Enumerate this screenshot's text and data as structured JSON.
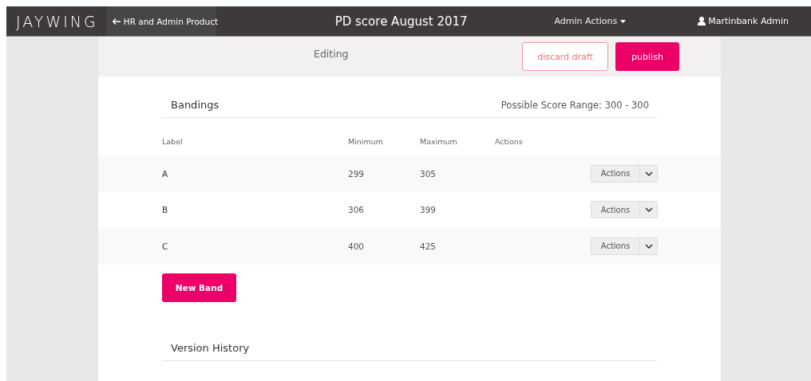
{
  "topbar": {
    "logo": "JAYWING",
    "back_link": "HR and Admin Product",
    "title": "PD score August 2017",
    "admin_menu": "Admin Actions",
    "user": "Martinbank Admin"
  },
  "edit_bar": {
    "status": "Editing",
    "buttons": [
      {
        "kind": "outline",
        "label": "discard draft"
      },
      {
        "kind": "primary",
        "label": "publish"
      }
    ]
  },
  "bandings": {
    "title": "Bandings",
    "score_range": "Possible Score Range: 300 - 300",
    "columns": [
      "Label",
      "Minimum",
      "Maximum",
      "Actions"
    ],
    "rows": [
      {
        "label": "A",
        "minimum": "299",
        "maximum": "305",
        "action": "Actions"
      },
      {
        "label": "B",
        "minimum": "306",
        "maximum": "399",
        "action": "Actions"
      },
      {
        "label": "C",
        "minimum": "400",
        "maximum": "425",
        "action": "Actions"
      }
    ],
    "new_button": "New Band"
  },
  "version_history": {
    "title": "Version History"
  }
}
